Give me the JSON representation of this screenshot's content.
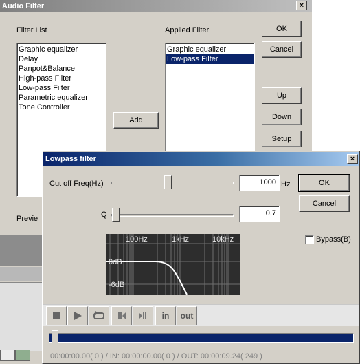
{
  "audio_filter": {
    "title": "Audio Filter",
    "close": "×",
    "filter_list_label": "Filter List",
    "filter_list": [
      "Graphic equalizer",
      "Delay",
      "Panpot&Balance",
      "High-pass Filter",
      "Low-pass Filter",
      "Parametric equalizer",
      "Tone Controller"
    ],
    "applied_label": "Applied Filter",
    "applied": [
      "Graphic equalizer",
      "Low-pass Filter"
    ],
    "applied_selected": "Low-pass Filter",
    "add_button": "Add",
    "ok_button": "OK",
    "cancel_button": "Cancel",
    "up_button": "Up",
    "down_button": "Down",
    "setup_button": "Setup",
    "preview_label": "Previe"
  },
  "lowpass": {
    "title": "Lowpass filter",
    "close": "×",
    "cutoff_label": "Cut off Freq(Hz)",
    "cutoff_value": "1000",
    "cutoff_unit": "Hz",
    "q_label": "Q",
    "q_value": "0.7",
    "ok_button": "OK",
    "cancel_button": "Cancel",
    "bypass_label": "Bypass(B)",
    "bypass_checked": false,
    "graph": {
      "freq_labels": [
        "100Hz",
        "1kHz",
        "10kHz"
      ],
      "db_labels": [
        "0dB",
        "-6dB"
      ]
    },
    "transport": {
      "stop_icon": "stop-icon",
      "play_icon": "play-icon",
      "loop_icon": "loop-icon",
      "prev_icon": "prev-frame-icon",
      "next_icon": "next-frame-icon",
      "in_label": "in",
      "out_label": "out"
    },
    "status": "00:00:00.00( 0 ) / IN: 00:00:00.00( 0 ) / OUT: 00:00:09.24( 249 )"
  },
  "colors": {
    "selection": "#0a246a",
    "lp_title_start": "#0a246a",
    "lp_title_end": "#a6caf0",
    "graph_bg": "#2d2d2d",
    "curve": "#ffffff"
  }
}
